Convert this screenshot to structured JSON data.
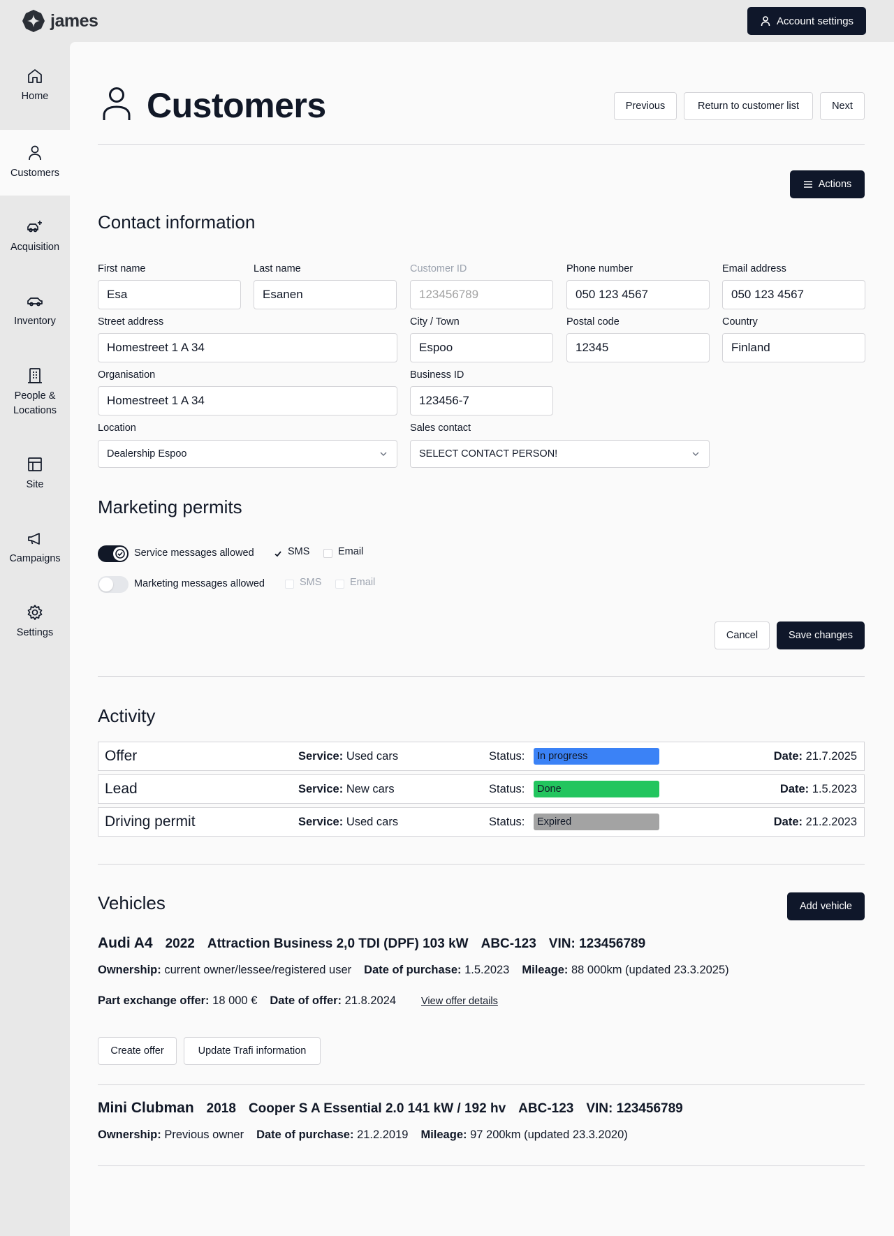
{
  "app": {
    "name": "james"
  },
  "header": {
    "account_label": "Account settings"
  },
  "sidebar": {
    "items": [
      {
        "label": "Home",
        "icon": "home-icon"
      },
      {
        "label": "Customers",
        "icon": "user-icon",
        "active": true
      },
      {
        "label": "Acquisition",
        "icon": "car-plus-icon"
      },
      {
        "label": "Inventory",
        "icon": "car-icon"
      },
      {
        "label": "People &\nLocations",
        "icon": "building-icon"
      },
      {
        "label": "Site",
        "icon": "layout-icon"
      },
      {
        "label": "Campaigns",
        "icon": "megaphone-icon"
      },
      {
        "label": "Settings",
        "icon": "gear-icon"
      }
    ]
  },
  "page": {
    "title": "Customers",
    "nav": {
      "previous": "Previous",
      "return": "Return to customer list",
      "next": "Next"
    },
    "actions_label": "Actions"
  },
  "contact": {
    "heading": "Contact information",
    "first_name": {
      "label": "First name",
      "value": "Esa"
    },
    "last_name": {
      "label": "Last name",
      "value": "Esanen"
    },
    "customer_id": {
      "label": "Customer ID",
      "value": "123456789"
    },
    "phone": {
      "label": "Phone number",
      "value": "050 123 4567"
    },
    "email": {
      "label": "Email address",
      "value": "050 123 4567"
    },
    "street": {
      "label": "Street address",
      "value": "Homestreet 1 A 34"
    },
    "city": {
      "label": "City / Town",
      "value": "Espoo"
    },
    "postal": {
      "label": "Postal code",
      "value": "12345"
    },
    "country": {
      "label": "Country",
      "value": "Finland"
    },
    "organisation": {
      "label": "Organisation",
      "value": "Homestreet 1 A 34"
    },
    "business_id": {
      "label": "Business ID",
      "value": "123456-7"
    },
    "location": {
      "label": "Location",
      "value": "Dealership Espoo"
    },
    "sales_contact": {
      "label": "Sales contact",
      "value": "SELECT CONTACT PERSON!"
    }
  },
  "marketing": {
    "heading": "Marketing permits",
    "service": {
      "label": "Service messages allowed",
      "enabled": true,
      "sms": "SMS",
      "email": "Email",
      "sms_checked": true,
      "email_checked": false
    },
    "marketing": {
      "label": "Marketing messages allowed",
      "enabled": false,
      "sms": "SMS",
      "email": "Email",
      "sms_checked": false,
      "email_checked": false
    }
  },
  "form_buttons": {
    "cancel": "Cancel",
    "save": "Save changes"
  },
  "activity": {
    "heading": "Activity",
    "service_label": "Service:",
    "status_label": "Status:",
    "date_label": "Date:",
    "rows": [
      {
        "type": "Offer",
        "service": "Used cars",
        "status": "In progress",
        "status_color": "#3b82f6",
        "date": "21.7.2025"
      },
      {
        "type": "Lead",
        "service": "New cars",
        "status": "Done",
        "status_color": "#22c55e",
        "date": "1.5.2023"
      },
      {
        "type": "Driving permit",
        "service": "Used cars",
        "status": "Expired",
        "status_color": "#a3a3a3",
        "date": "21.2.2023"
      }
    ]
  },
  "vehicles": {
    "heading": "Vehicles",
    "add_label": "Add vehicle",
    "items": [
      {
        "model": "Audi A4",
        "year": "2022",
        "variant": "Attraction Business 2,0 TDI (DPF) 103 kW",
        "plate": "ABC-123",
        "vin": "VIN: 123456789",
        "ownership_label": "Ownership:",
        "ownership": "current owner/lessee/registered user",
        "purchase_label": "Date of purchase:",
        "purchase": "1.5.2023",
        "mileage_label": "Mileage:",
        "mileage": "88 000km (updated 23.3.2025)",
        "offer_label": "Part exchange offer:",
        "offer": "18 000 €",
        "offer_date_label": "Date of offer:",
        "offer_date": "21.8.2024",
        "details_link": "View offer details",
        "create_offer": "Create offer",
        "update_trafi": "Update Trafi information"
      },
      {
        "model": "Mini Clubman",
        "year": "2018",
        "variant": "Cooper S A Essential 2.0 141 kW / 192 hv",
        "plate": "ABC-123",
        "vin": "VIN: 123456789",
        "ownership_label": "Ownership:",
        "ownership": "Previous owner",
        "purchase_label": "Date of purchase:",
        "purchase": "21.2.2019",
        "mileage_label": "Mileage:",
        "mileage": "97 200km (updated 23.3.2020)"
      }
    ]
  },
  "colors": {
    "primary": "#0f172a",
    "panel": "#fafafa",
    "background": "#e8e8e8",
    "border": "#d4d4d8"
  }
}
